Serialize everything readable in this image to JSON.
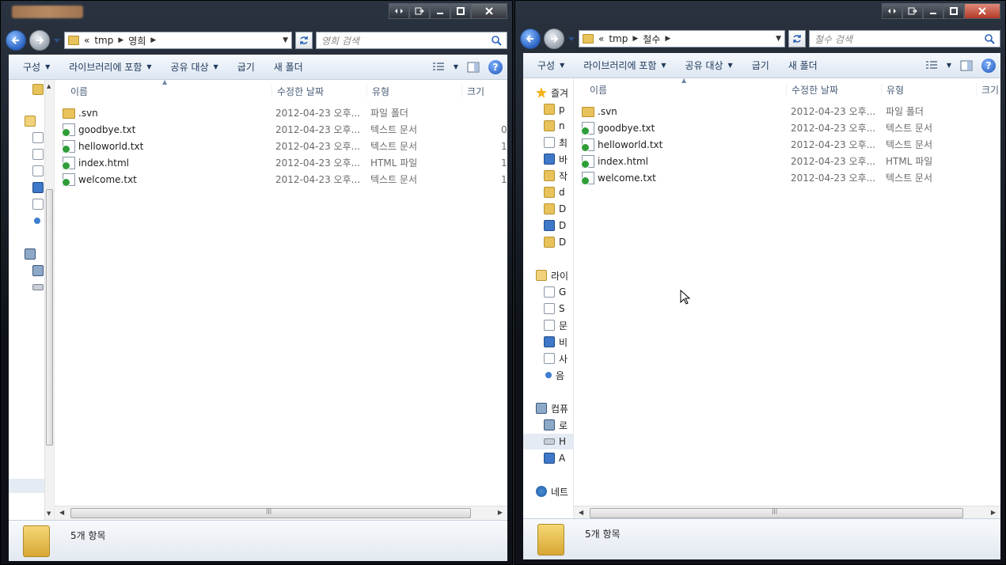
{
  "left": {
    "address": {
      "segments": [
        "«",
        "tmp",
        "영희"
      ]
    },
    "search_placeholder": "영희 검색",
    "toolbar": {
      "organize": "구성",
      "include_library": "라이브러리에 포함",
      "share": "공유 대상",
      "burn": "굽기",
      "new_folder": "새 폴더"
    },
    "columns": {
      "name": "이름",
      "date": "수정한 날짜",
      "type": "유형",
      "size": "크기"
    },
    "files": [
      {
        "name": ".svn",
        "date": "2012-04-23 오후...",
        "type": "파일 폴더",
        "size": "",
        "kind": "folder"
      },
      {
        "name": "goodbye.txt",
        "date": "2012-04-23 오후...",
        "type": "텍스트 문서",
        "size": "0",
        "kind": "file"
      },
      {
        "name": "helloworld.txt",
        "date": "2012-04-23 오후...",
        "type": "텍스트 문서",
        "size": "1",
        "kind": "file"
      },
      {
        "name": "index.html",
        "date": "2012-04-23 오후...",
        "type": "HTML 파일",
        "size": "1",
        "kind": "file"
      },
      {
        "name": "welcome.txt",
        "date": "2012-04-23 오후...",
        "type": "텍스트 문서",
        "size": "1",
        "kind": "file"
      }
    ],
    "status": "5개 항목"
  },
  "right": {
    "address": {
      "segments": [
        "«",
        "tmp",
        "철수"
      ]
    },
    "search_placeholder": "철수 검색",
    "toolbar": {
      "organize": "구성",
      "include_library": "라이브러리에 포함",
      "share": "공유 대상",
      "burn": "굽기",
      "new_folder": "새 폴더"
    },
    "columns": {
      "name": "이름",
      "date": "수정한 날짜",
      "type": "유형",
      "size": "크기"
    },
    "nav": [
      {
        "label": "즐겨",
        "icon": "star"
      },
      {
        "label": "p",
        "icon": "folder"
      },
      {
        "label": "n",
        "icon": "folder"
      },
      {
        "label": "최",
        "icon": "doc"
      },
      {
        "label": "바",
        "icon": "blue"
      },
      {
        "label": "작",
        "icon": "folder"
      },
      {
        "label": "d",
        "icon": "folder"
      },
      {
        "label": "D",
        "icon": "folder"
      },
      {
        "label": "D",
        "icon": "blue"
      },
      {
        "label": "D",
        "icon": "folder"
      },
      {
        "label": "라이",
        "icon": "lib"
      },
      {
        "label": "G",
        "icon": "doc"
      },
      {
        "label": "S",
        "icon": "doc"
      },
      {
        "label": "문",
        "icon": "doc"
      },
      {
        "label": "비",
        "icon": "blue"
      },
      {
        "label": "사",
        "icon": "doc"
      },
      {
        "label": "음",
        "icon": "music"
      },
      {
        "label": "컴퓨",
        "icon": "pc"
      },
      {
        "label": "로",
        "icon": "pc"
      },
      {
        "label": "H",
        "icon": "drive"
      },
      {
        "label": "A",
        "icon": "blue"
      },
      {
        "label": "네트",
        "icon": "net"
      }
    ],
    "files": [
      {
        "name": ".svn",
        "date": "2012-04-23 오후...",
        "type": "파일 폴더",
        "kind": "folder"
      },
      {
        "name": "goodbye.txt",
        "date": "2012-04-23 오후...",
        "type": "텍스트 문서",
        "kind": "file"
      },
      {
        "name": "helloworld.txt",
        "date": "2012-04-23 오후...",
        "type": "텍스트 문서",
        "kind": "file"
      },
      {
        "name": "index.html",
        "date": "2012-04-23 오후...",
        "type": "HTML 파일",
        "kind": "file"
      },
      {
        "name": "welcome.txt",
        "date": "2012-04-23 오후...",
        "type": "텍스트 문서",
        "kind": "file"
      }
    ],
    "status": "5개 항목"
  }
}
